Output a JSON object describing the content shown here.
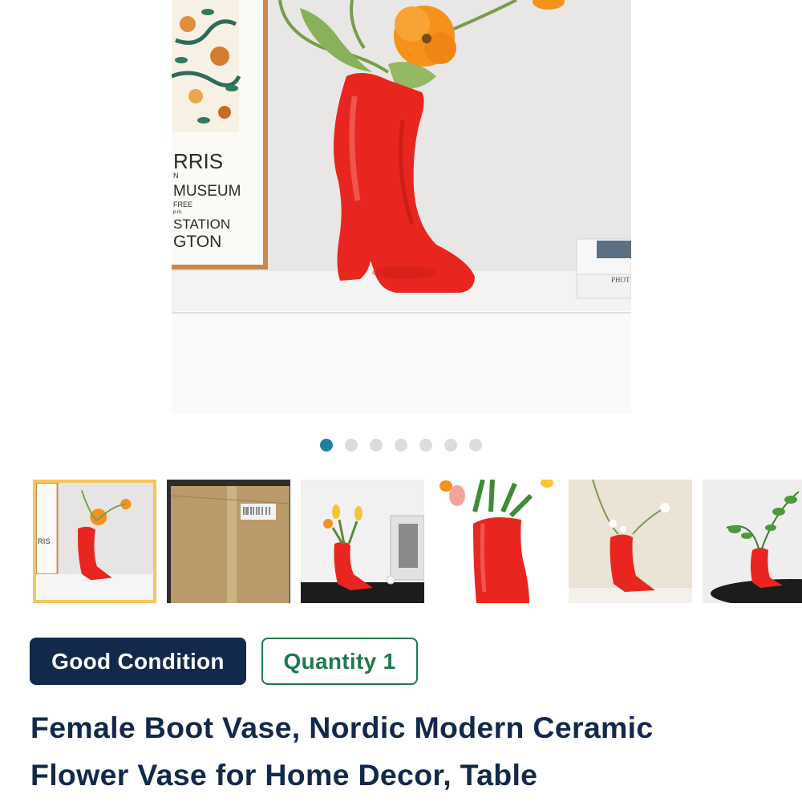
{
  "product": {
    "image_alt": "Red ceramic boot vase with orange poppies on a white shelf",
    "poster_lines": [
      "RRIS",
      "N",
      "MUSEUM",
      "FREE",
      "p.m.",
      "STATION",
      "GTON"
    ],
    "book_label": "PHOT",
    "carousel": {
      "total": 7,
      "active_index": 0
    },
    "thumbnails": [
      {
        "name": "thumb-boot-poppies",
        "selected": true
      },
      {
        "name": "thumb-cardboard-box",
        "selected": false
      },
      {
        "name": "thumb-boot-tulips-table",
        "selected": false
      },
      {
        "name": "thumb-boot-closeup-tulips",
        "selected": false
      },
      {
        "name": "thumb-boot-white-flowers",
        "selected": false
      },
      {
        "name": "thumb-boot-green-leaves",
        "selected": false
      }
    ],
    "badges": {
      "condition": "Good Condition",
      "quantity": "Quantity 1"
    },
    "title_line1": "Female Boot Vase, Nordic Modern Ceramic",
    "title_line2": "Flower Vase for Home Decor, Table"
  },
  "colors": {
    "navy": "#13294b",
    "green": "#1e7a4b",
    "accent_dot": "#1e7fa0",
    "selected_border": "#f4c55d",
    "boot_red": "#e8261f"
  }
}
